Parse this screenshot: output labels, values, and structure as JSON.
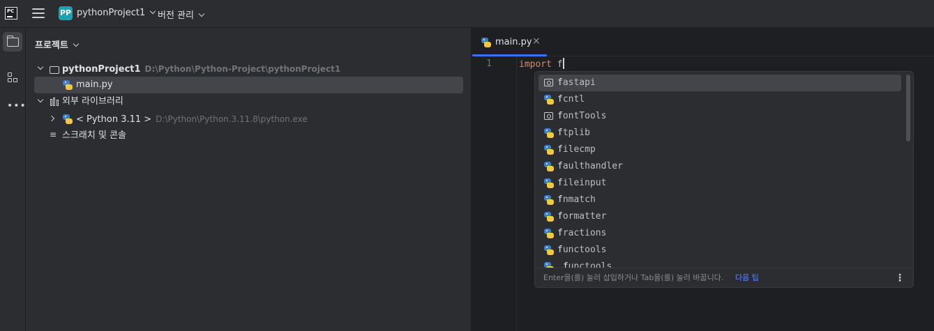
{
  "titlebar": {
    "logo_text": "PC",
    "project_badge": "PP",
    "project_name": "pythonProject1",
    "vcs_label": "버전 관리"
  },
  "project_panel": {
    "title": "프로젝트",
    "tree": {
      "root_name": "pythonProject1",
      "root_path": "D:\\Python\\Python-Project\\pythonProject1",
      "file_main": "main.py",
      "external_libs": "외부 라이브러리",
      "python_sdk_name": "< Python 3.11 >",
      "python_sdk_path": "D:\\Python\\Python.3.11.8\\python.exe",
      "scratches": "스크래치 및 콘솔"
    }
  },
  "editor": {
    "tab_label": "main.py",
    "line_number": "1",
    "code_keyword": "import",
    "code_rest": " f"
  },
  "completion": {
    "items": [
      {
        "first": "f",
        "rest": "astapi",
        "icon": "package-icon"
      },
      {
        "first": "f",
        "rest": "cntl",
        "icon": "python-icon"
      },
      {
        "first": "f",
        "rest": "ontTools",
        "icon": "package-icon"
      },
      {
        "first": "f",
        "rest": "tplib",
        "icon": "python-icon"
      },
      {
        "first": "f",
        "rest": "ilecmp",
        "icon": "python-icon"
      },
      {
        "first": "f",
        "rest": "aulthandler",
        "icon": "python-icon"
      },
      {
        "first": "f",
        "rest": "ileinput",
        "icon": "python-icon"
      },
      {
        "first": "f",
        "rest": "nmatch",
        "icon": "python-icon"
      },
      {
        "first": "f",
        "rest": "ormatter",
        "icon": "python-icon"
      },
      {
        "first": "f",
        "rest": "ractions",
        "icon": "python-icon"
      },
      {
        "first": "f",
        "rest": "unctools",
        "icon": "python-icon"
      },
      {
        "first": "_f",
        "rest": "unctools",
        "icon": "python-icon"
      }
    ],
    "footer_hint": "Enter을(를) 눌러 삽입하거나 Tab을(를) 눌러 바꿉니다.",
    "footer_link": "다음 팁",
    "footer_menu": "⋮"
  },
  "colors": {
    "accent": "#3574f0",
    "keyword": "#cf8e6d",
    "link": "#548af7"
  }
}
